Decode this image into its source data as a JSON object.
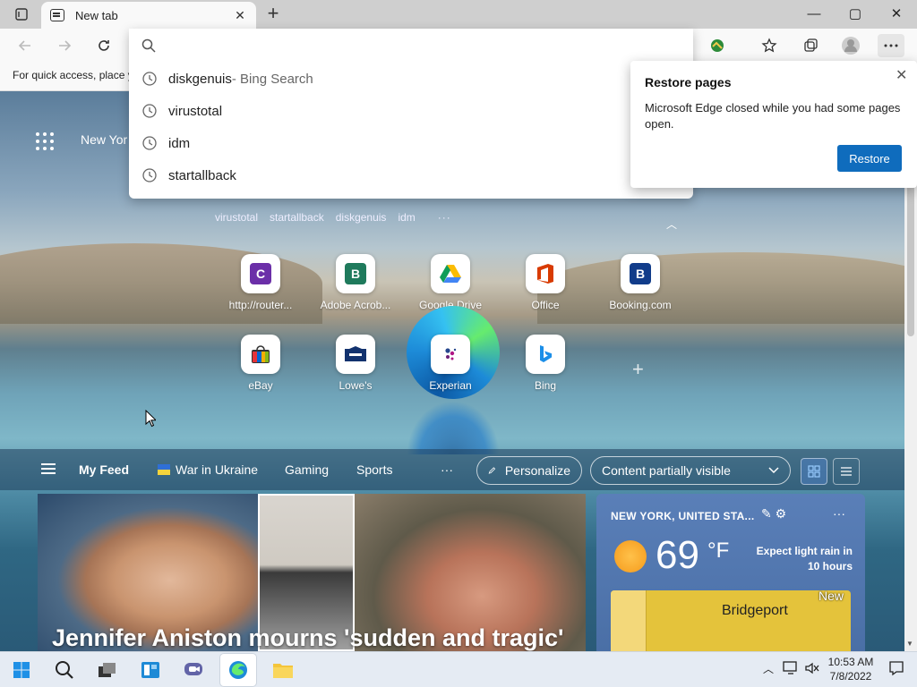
{
  "browser": {
    "tab_title": "New tab",
    "favbar_text": "For quick access, place y",
    "new_tab_symbol": "+",
    "close_symbol": "✕",
    "window_controls": {
      "minimize": "—",
      "maximize": "▢",
      "close": "✕"
    },
    "icons": [
      "back-icon",
      "forward-icon",
      "refresh-icon",
      "search-icon",
      "extension-icon",
      "favorites-icon",
      "collections-icon",
      "profile-icon",
      "more-icon"
    ]
  },
  "omnibox": {
    "value": "",
    "suggestions": [
      {
        "text": "diskgenuis",
        "suffix": " - Bing Search"
      },
      {
        "text": "virustotal",
        "suffix": ""
      },
      {
        "text": "idm",
        "suffix": ""
      },
      {
        "text": "startallback",
        "suffix": ""
      }
    ]
  },
  "restore_popup": {
    "title": "Restore pages",
    "body": "Microsoft Edge closed while you had some pages open.",
    "button": "Restore"
  },
  "newtab": {
    "location_short": "New Yor",
    "quick_searches": [
      "virustotal",
      "startallback",
      "diskgenuis",
      "idm"
    ],
    "more": "···",
    "tiles_row1": [
      {
        "name": "http://router...",
        "letter": "C",
        "color": "#6b2fa8"
      },
      {
        "name": "Adobe Acrob...",
        "letter": "B",
        "color": "#1f7a5c"
      },
      {
        "name": "Google Drive",
        "letter": "",
        "color": ""
      },
      {
        "name": "Office",
        "letter": "",
        "color": ""
      },
      {
        "name": "Booking.com",
        "letter": "B",
        "color": "#113c8a"
      }
    ],
    "tiles_row2": [
      {
        "name": "eBay"
      },
      {
        "name": "Lowe's"
      },
      {
        "name": "Experian"
      },
      {
        "name": "Bing"
      }
    ]
  },
  "feed_nav": {
    "my_feed": "My Feed",
    "items": [
      "War in Ukraine",
      "Gaming",
      "Sports"
    ],
    "more": "···",
    "personalize": "Personalize",
    "content_visibility": "Content partially visible"
  },
  "news": {
    "headline": "Jennifer Aniston mourns 'sudden and tragic'"
  },
  "weather": {
    "location": "NEW YORK, UNITED STA...",
    "temp": "69",
    "unit": "°F",
    "message": "Expect light rain in 10 hours",
    "map_city": "Bridgeport",
    "map_label": "New"
  },
  "taskbar": {
    "time": "10:53 AM",
    "date": "7/8/2022"
  },
  "colors": {
    "accent": "#0f6cbd",
    "weather_card": "#5a7fb8"
  }
}
